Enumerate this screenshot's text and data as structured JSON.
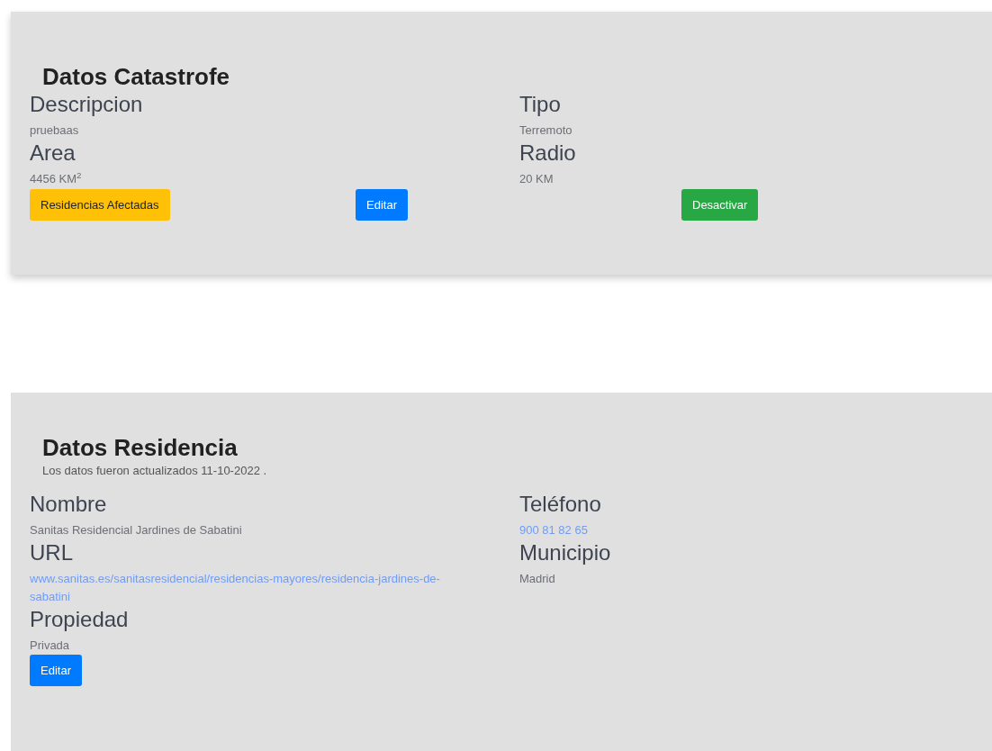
{
  "catastrofe": {
    "title": "Datos Catastrofe",
    "columns": [
      [
        {
          "label": "Descripcion",
          "value": "pruebaas",
          "kind": "text"
        },
        {
          "label": "Area",
          "value": "4456 KM$^{2}$",
          "kind": "text"
        }
      ],
      [
        {
          "label": "Tipo",
          "value": "Terremoto",
          "kind": "text"
        },
        {
          "label": "Radio",
          "value": "20 KM",
          "kind": "text"
        }
      ]
    ],
    "buttons": [
      {
        "label": "Residencias Afectadas",
        "kind": "warning"
      },
      {
        "label": "Editar",
        "kind": "primary"
      },
      {
        "label": "Desactivar",
        "kind": "success"
      }
    ]
  },
  "residencia": {
    "title": "Datos Residencia",
    "subtitle": "Los datos fueron actualizados 11-10-2022 .",
    "columns": [
      [
        {
          "label": "Nombre",
          "value": "Sanitas Residencial Jardines de Sabatini",
          "kind": "text"
        },
        {
          "label": "URL",
          "value": "www.sanitas.es/sanitasresidencial/residencias-mayores/residencia-jardines-de-sabatini",
          "kind": "link"
        },
        {
          "label": "Propiedad",
          "value": "Privada",
          "kind": "text"
        }
      ],
      [
        {
          "label": "Teléfono",
          "value": "900 81 82 65",
          "kind": "link"
        },
        {
          "label": "Municipio",
          "value": "Madrid",
          "kind": "text"
        }
      ]
    ],
    "buttons": [
      {
        "label": "Editar",
        "kind": "primary"
      }
    ]
  }
}
